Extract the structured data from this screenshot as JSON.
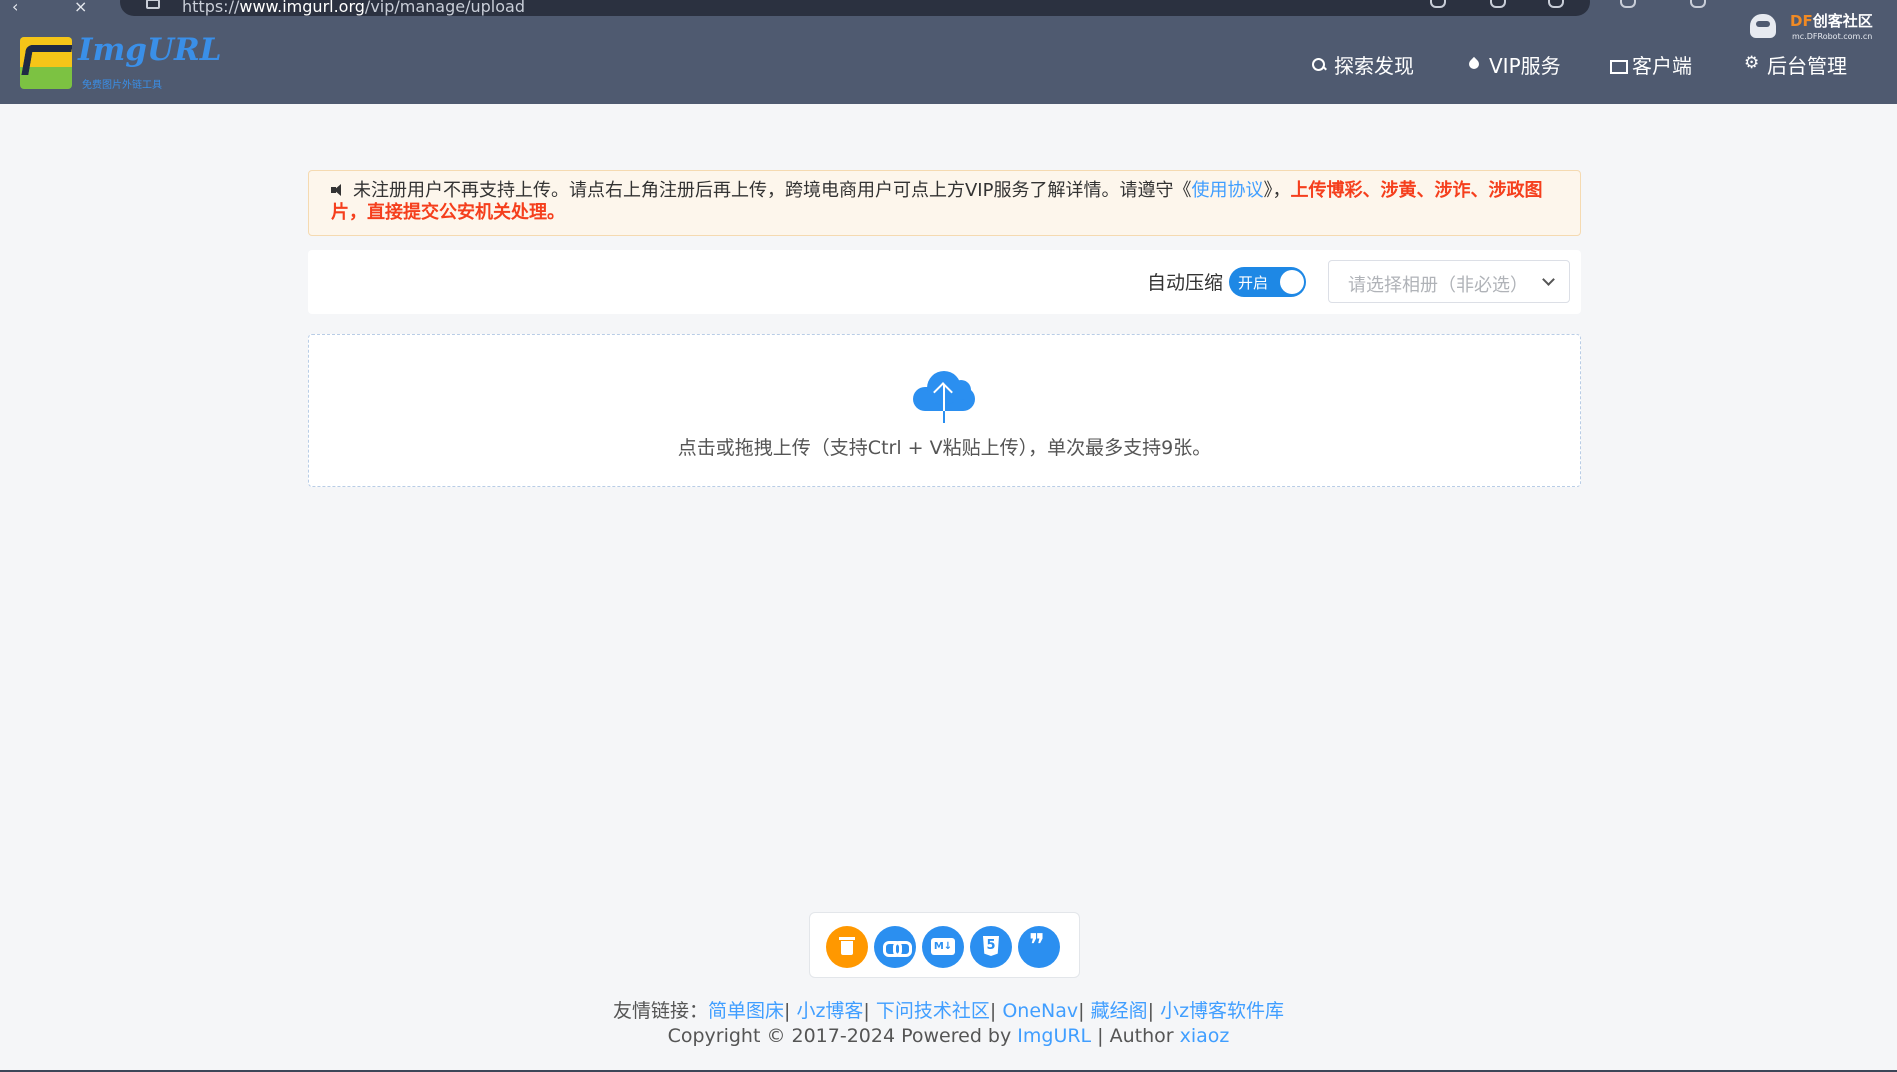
{
  "browser": {
    "url_prefix": "https://",
    "url_domain": "www.imgurl.org",
    "url_path": "/vip/manage/upload"
  },
  "header": {
    "logo_title": "ImgURL",
    "logo_subtitle": "免费图片外链工具",
    "nav": [
      {
        "label": "探索发现",
        "icon": "search-icon"
      },
      {
        "label": "VIP服务",
        "icon": "drop-icon"
      },
      {
        "label": "客户端",
        "icon": "screen-icon"
      },
      {
        "label": "后台管理",
        "icon": "gear-icon"
      }
    ]
  },
  "watermark": {
    "brand_df": "DF",
    "brand_text": "创客社区",
    "url": "mc.DFRobot.com.cn"
  },
  "notice": {
    "text_before": "未注册用户不再支持上传。请点右上角注册后再上传，跨境电商用户可点上方VIP服务了解详情。请遵守《",
    "link": "使用协议",
    "text_after": "》，",
    "warning": "上传博彩、涉黄、涉诈、涉政图片，直接提交公安机关处理。"
  },
  "options": {
    "compress_label": "自动压缩",
    "toggle_text": "开启",
    "toggle_on": true,
    "album_placeholder": "请选择相册（非必选）"
  },
  "upload": {
    "hint": "点击或拖拽上传（支持Ctrl + V粘贴上传），单次最多支持9张。"
  },
  "actions": [
    {
      "name": "clear-button",
      "icon": "trash-icon",
      "color": "#ff9800"
    },
    {
      "name": "copy-url-button",
      "icon": "link-icon",
      "color": "#2b8ff0"
    },
    {
      "name": "copy-markdown-button",
      "icon": "markdown-icon",
      "color": "#2b8ff0"
    },
    {
      "name": "copy-html-button",
      "icon": "html5-icon",
      "color": "#2b8ff0"
    },
    {
      "name": "copy-bbcode-button",
      "icon": "quote-icon",
      "color": "#2b8ff0"
    }
  ],
  "footer": {
    "links_label": "友情链接：",
    "links": [
      "简单图床",
      "小z博客",
      "下问技术社区",
      "OneNav",
      "藏经阁",
      "小z博客软件库"
    ],
    "separator": "|",
    "copyright_prefix": "Copyright © 2017-2024 Powered by ",
    "powered_by": "ImgURL",
    "author_prefix": " | Author ",
    "author": "xiaoz"
  },
  "colors": {
    "header_bg": "#4f5a70",
    "accent": "#409eff",
    "warning": "#f53f1d",
    "clear_button": "#ff9800"
  }
}
